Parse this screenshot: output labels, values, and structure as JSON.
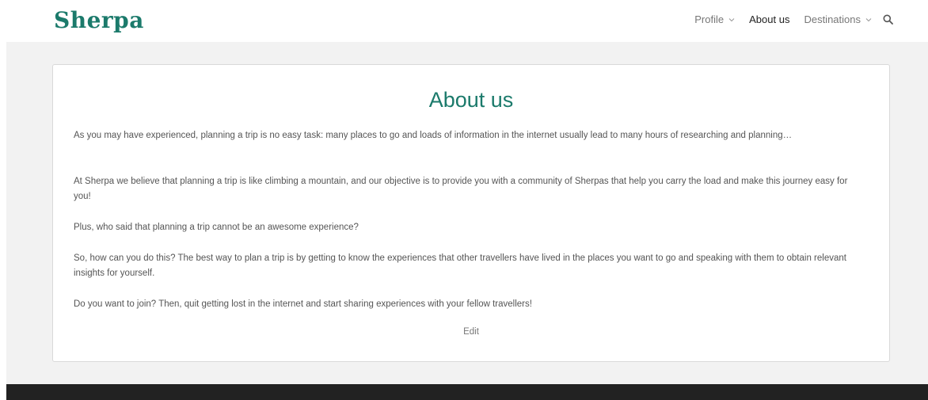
{
  "header": {
    "brand": "Sherpa",
    "nav": {
      "profile_label": "Profile",
      "about_label": "About us",
      "destinations_label": "Destinations"
    }
  },
  "main": {
    "title": "About us",
    "paragraphs": [
      "As you may have experienced, planning a trip is no easy task: many places to go and loads of information in the internet usually lead to many hours of researching and planning…",
      "At Sherpa we believe that planning a trip is like climbing a mountain, and our objective is to provide you with a community of Sherpas that help you carry the load and make this journey easy for you!",
      "Plus, who said that planning a trip cannot be an awesome experience?",
      "So, how can you do this? The best way to plan a trip is by getting to know the experiences that other travellers have lived in the places you want to go and speaking with them to obtain relevant insights for yourself.",
      "Do you want to join? Then, quit getting lost in the internet and start sharing experiences with your fellow travellers!"
    ],
    "edit_label": "Edit"
  },
  "colors": {
    "brand": "#1b7a6b",
    "background": "#f2f2f2",
    "footer": "#222222"
  },
  "icons": {
    "search": "search-icon",
    "dropdown": "chevron-down-icon"
  }
}
